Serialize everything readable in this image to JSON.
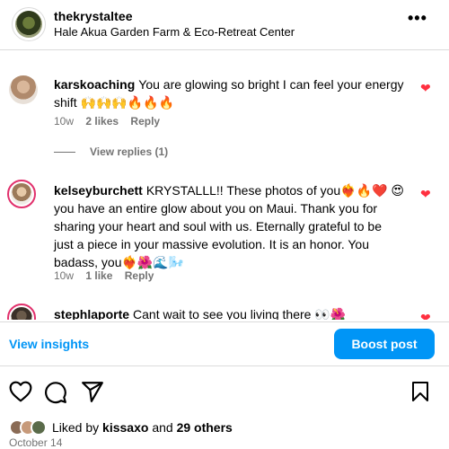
{
  "header": {
    "username": "thekrystaltee",
    "location": "Hale Akua Garden Farm & Eco-Retreat Center",
    "more_icon": "more-dots-icon",
    "more_label": "•••"
  },
  "comments": [
    {
      "username": "karskoaching",
      "text": "You are glowing so bright I can feel your energy shift 🙌🙌🙌🔥🔥🔥",
      "age": "10w",
      "likes": "2 likes",
      "reply": "Reply",
      "view_replies": "View replies (1)"
    },
    {
      "username": "kelseyburchett",
      "text": "KRYSTALLL!! These photos of you❤️‍🔥🔥❤️ 😍 you have an entire glow about you on Maui. Thank you for sharing your heart and soul with us. Eternally grateful to be just a piece in your massive evolution. It is an honor. You badass, you❤️‍🔥🌺🌊🌬️",
      "age": "10w",
      "likes": "1 like",
      "reply": "Reply"
    },
    {
      "username": "stephlaporte",
      "text": "Cant wait to see you living there 👀🌺"
    }
  ],
  "insights": {
    "view_label": "View insights",
    "boost_label": "Boost post"
  },
  "actions": {
    "like_icon": "heart-outline-icon",
    "comment_icon": "comment-icon",
    "share_icon": "share-icon",
    "save_icon": "bookmark-icon"
  },
  "likes": {
    "prefix": "Liked by",
    "user": "kissaxo",
    "and": "and",
    "others": "29 others"
  },
  "date": "October 14",
  "colors": {
    "accent": "#0095f6",
    "heart": "#ff3040",
    "muted": "#737373",
    "border": "#dbdbdb"
  }
}
